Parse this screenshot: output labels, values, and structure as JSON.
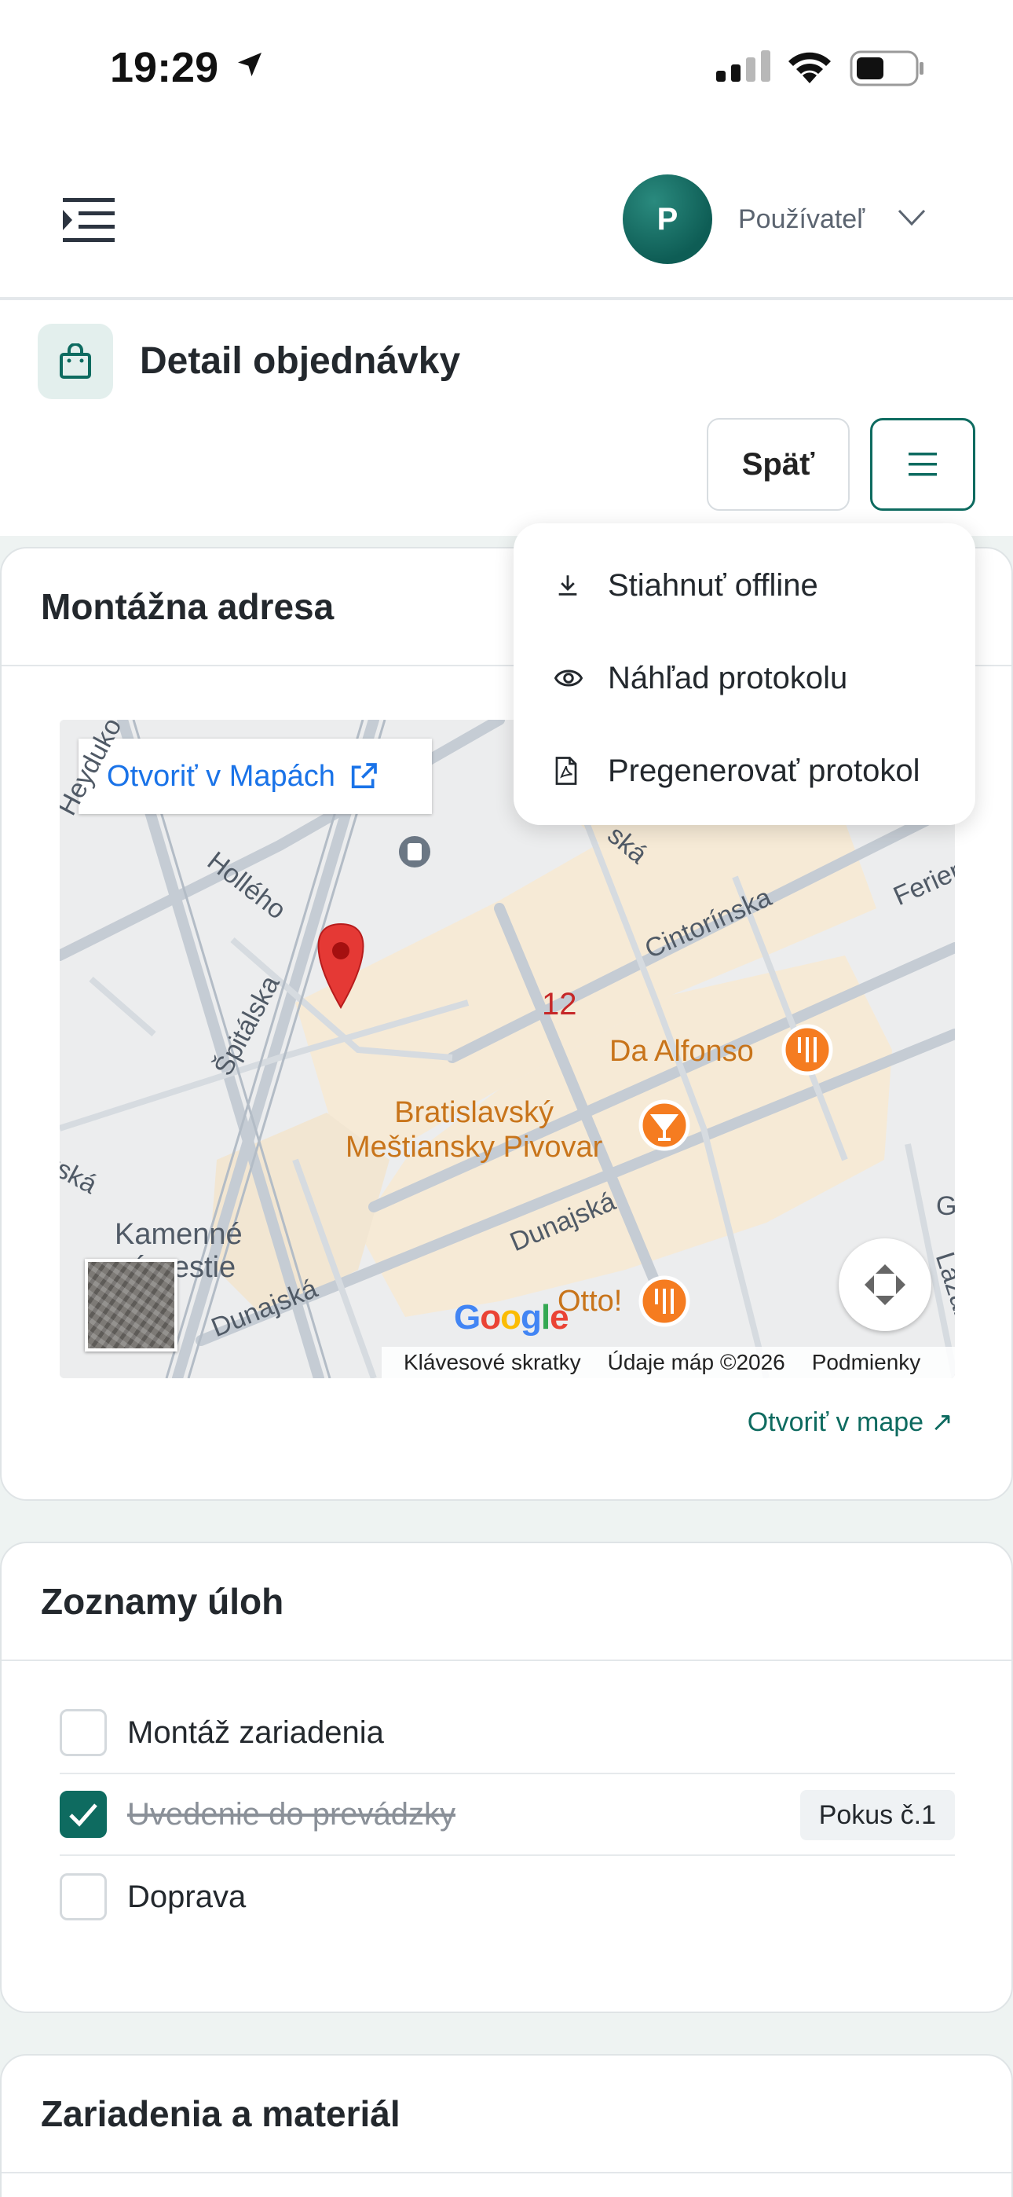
{
  "status_bar": {
    "time": "19:29"
  },
  "header": {
    "avatar_initial": "P",
    "user_name": "Používateľ"
  },
  "page": {
    "title": "Detail objednávky",
    "back_label": "Späť"
  },
  "dropdown": {
    "items": [
      {
        "label": "Stiahnuť offline",
        "icon": "download-icon"
      },
      {
        "label": "Náhľad protokolu",
        "icon": "eye-icon"
      },
      {
        "label": "Pregenerovať protokol",
        "icon": "pdf-file-icon"
      }
    ]
  },
  "address_card": {
    "title": "Montážna adresa",
    "open_in_maps_button": "Otvoriť v Mapách",
    "open_in_map_link": "Otvoriť v mape ↗",
    "map": {
      "pin_label": "12",
      "streets": [
        "Heydukova",
        "Hollého",
        "Špitálska",
        "Cintorínska",
        "Ferien",
        "Dunajská",
        "Dunajská",
        "rská",
        "ská",
        "Lazar",
        "G"
      ],
      "pois": [
        "Da Alfonso",
        "Bratislavský\nMeštiansky Pivovar",
        "Otto!",
        "Kamenné\nnámestie"
      ],
      "google_logo": "Google",
      "footer": {
        "shortcuts": "Klávesové skratky",
        "map_data": "Údaje máp ©2026",
        "terms": "Podmienky"
      }
    }
  },
  "tasks_card": {
    "title": "Zoznamy úloh",
    "tasks": [
      {
        "label": "Montáž zariadenia",
        "checked": false
      },
      {
        "label": "Uvedenie do prevádzky",
        "checked": true,
        "badge": "Pokus č.1"
      },
      {
        "label": "Doprava",
        "checked": false
      }
    ]
  },
  "materials_card": {
    "title": "Zariadenia a materiál"
  },
  "colors": {
    "accent": "#0e6b60",
    "link_blue": "#1a73e8",
    "poi_orange": "#c8741a"
  }
}
